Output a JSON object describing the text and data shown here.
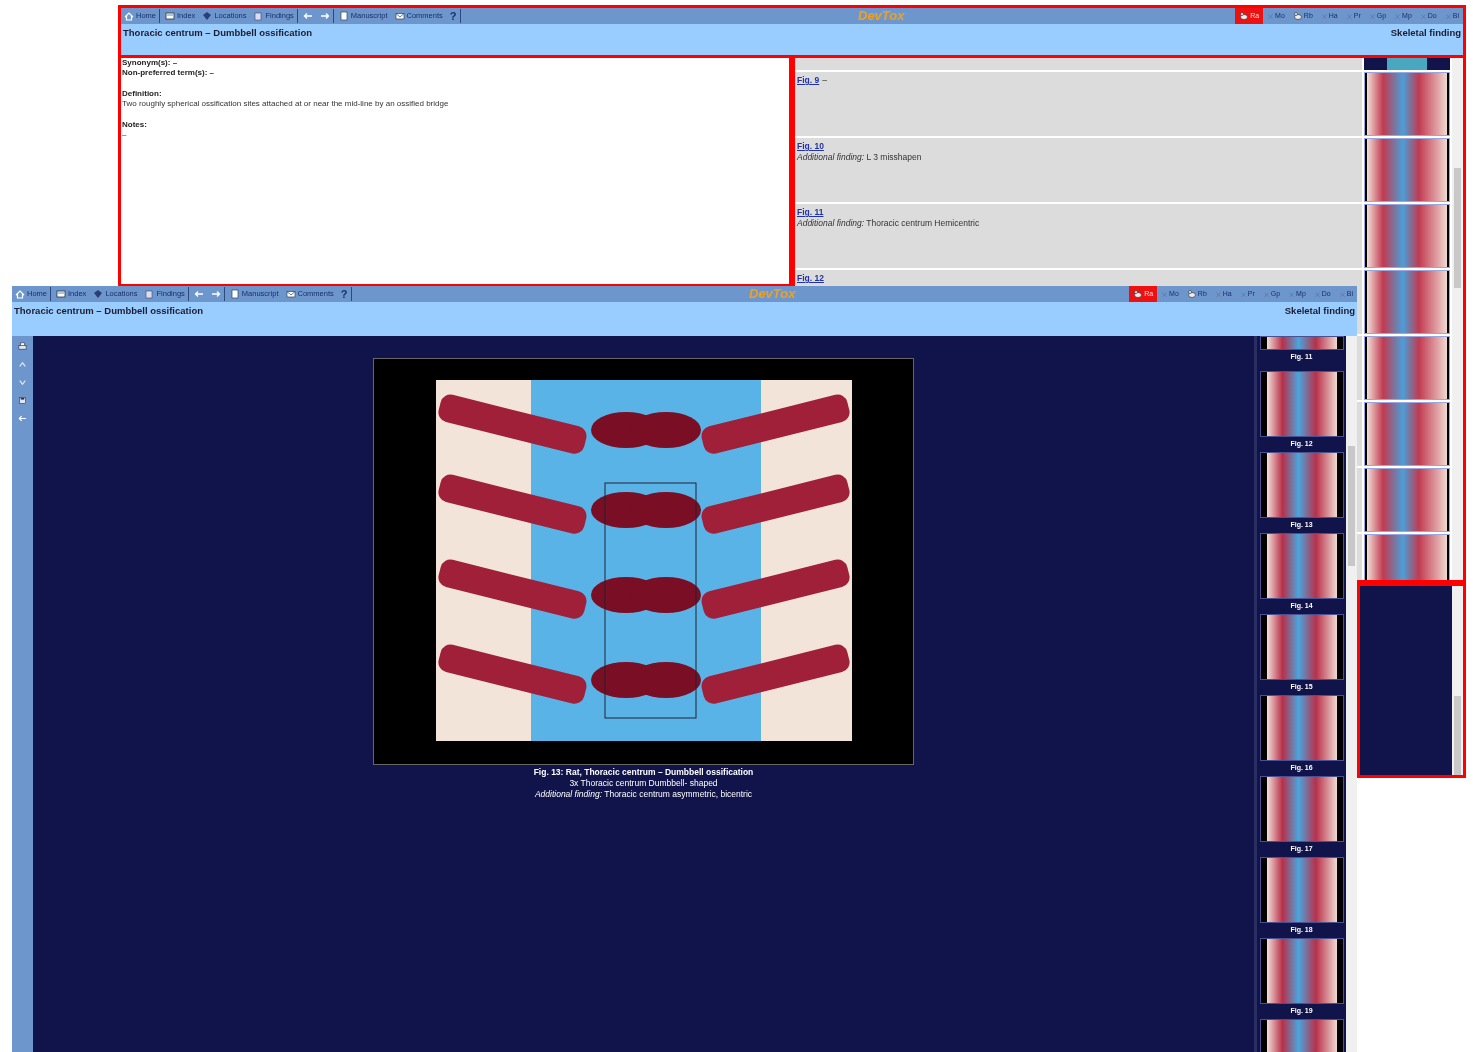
{
  "top_window": {
    "toolbar": [
      {
        "kind": "home",
        "label": "Home",
        "divider_after": true
      },
      {
        "kind": "index",
        "label": "Index",
        "divider_after": false
      },
      {
        "kind": "locations",
        "label": "Locations",
        "divider_after": false
      },
      {
        "kind": "findings",
        "label": "Findings",
        "divider_after": true
      },
      {
        "kind": "back",
        "divider_after": false
      },
      {
        "kind": "forward",
        "divider_after": true
      },
      {
        "kind": "manuscript",
        "label": "Manuscript",
        "divider_after": false
      },
      {
        "kind": "comments",
        "label": "Comments",
        "divider_after": false
      },
      {
        "kind": "help",
        "label": "?",
        "divider_after": true
      }
    ],
    "logo": "DevTox",
    "species": [
      {
        "label": "Ra",
        "available": true,
        "selected": true
      },
      {
        "label": "Mo",
        "available": false,
        "selected": false
      },
      {
        "label": "Rb",
        "available": true,
        "selected": false
      },
      {
        "label": "Ha",
        "available": false,
        "selected": false
      },
      {
        "label": "Pr",
        "available": false,
        "selected": false
      },
      {
        "label": "Gp",
        "available": false,
        "selected": false
      },
      {
        "label": "Mp",
        "available": false,
        "selected": false
      },
      {
        "label": "Do",
        "available": false,
        "selected": false
      },
      {
        "label": "Bi",
        "available": false,
        "selected": false
      }
    ],
    "title": "Thoracic centrum – Dumbbell ossification",
    "category": "Skeletal finding",
    "details": {
      "synonyms": "Synonym(s): –",
      "non_preferred": "Non-preferred term(s): –",
      "definition_heading": "Definition:",
      "definition": "Two roughly spherical ossification sites attached at or near the mid-line by an ossified bridge",
      "notes_heading": "Notes:",
      "notes": "–"
    },
    "figures": [
      {
        "kind": "partial"
      },
      {
        "kind": "figure",
        "link": "Fig. 9",
        "text": "–"
      },
      {
        "kind": "figure",
        "link": "Fig. 10",
        "finding_label": "Additional finding:",
        "finding": "L 3 misshapen"
      },
      {
        "kind": "figure",
        "link": "Fig. 11",
        "finding_label": "Additional finding:",
        "finding": "Thoracic centrum Hemicentric"
      },
      {
        "kind": "figure",
        "link": "Fig. 12"
      },
      {
        "kind": "covered"
      },
      {
        "kind": "covered"
      },
      {
        "kind": "covered"
      },
      {
        "kind": "covered"
      }
    ]
  },
  "bottom_window": {
    "toolbar": [
      {
        "kind": "home",
        "label": "Home",
        "divider_after": true
      },
      {
        "kind": "index",
        "label": "Index",
        "divider_after": false
      },
      {
        "kind": "locations",
        "label": "Locations",
        "divider_after": false
      },
      {
        "kind": "findings",
        "label": "Findings",
        "divider_after": true
      },
      {
        "kind": "back",
        "divider_after": false
      },
      {
        "kind": "forward",
        "divider_after": true
      },
      {
        "kind": "manuscript",
        "label": "Manuscript",
        "divider_after": false
      },
      {
        "kind": "comments",
        "label": "Comments",
        "divider_after": false
      },
      {
        "kind": "help",
        "label": "?",
        "divider_after": true
      }
    ],
    "logo": "DevTox",
    "species": [
      {
        "label": "Ra",
        "available": true,
        "selected": true
      },
      {
        "label": "Mo",
        "available": false,
        "selected": false
      },
      {
        "label": "Rb",
        "available": true,
        "selected": false
      },
      {
        "label": "Ha",
        "available": false,
        "selected": false
      },
      {
        "label": "Pr",
        "available": false,
        "selected": false
      },
      {
        "label": "Gp",
        "available": false,
        "selected": false
      },
      {
        "label": "Mp",
        "available": false,
        "selected": false
      },
      {
        "label": "Do",
        "available": false,
        "selected": false
      },
      {
        "label": "Bi",
        "available": false,
        "selected": false
      }
    ],
    "title": "Thoracic centrum – Dumbbell ossification",
    "category": "Skeletal finding",
    "side_tools": [
      {
        "kind": "print"
      },
      {
        "kind": "zoom-in"
      },
      {
        "kind": "zoom-out"
      },
      {
        "kind": "save"
      },
      {
        "kind": "back"
      }
    ],
    "caption": {
      "title": "Fig. 13: Rat, Thoracic centrum – Dumbbell ossification",
      "detail": "3x Thoracic centrum Dumbbell- shaped",
      "finding_label": "Additional finding:",
      "finding": "Thoracic centrum asymmetric, bicentric"
    },
    "thumbnails": [
      {
        "kind": "partial",
        "label": "Fig. 11"
      },
      {
        "kind": "thumb",
        "label": "Fig. 12"
      },
      {
        "kind": "thumb",
        "label": "Fig. 13"
      },
      {
        "kind": "thumb",
        "label": "Fig. 14"
      },
      {
        "kind": "thumb",
        "label": "Fig. 15"
      },
      {
        "kind": "thumb",
        "label": "Fig. 16"
      },
      {
        "kind": "thumb",
        "label": "Fig. 17"
      },
      {
        "kind": "thumb",
        "label": "Fig. 18"
      },
      {
        "kind": "thumb",
        "label": "Fig. 19"
      },
      {
        "kind": "thumb"
      }
    ]
  }
}
